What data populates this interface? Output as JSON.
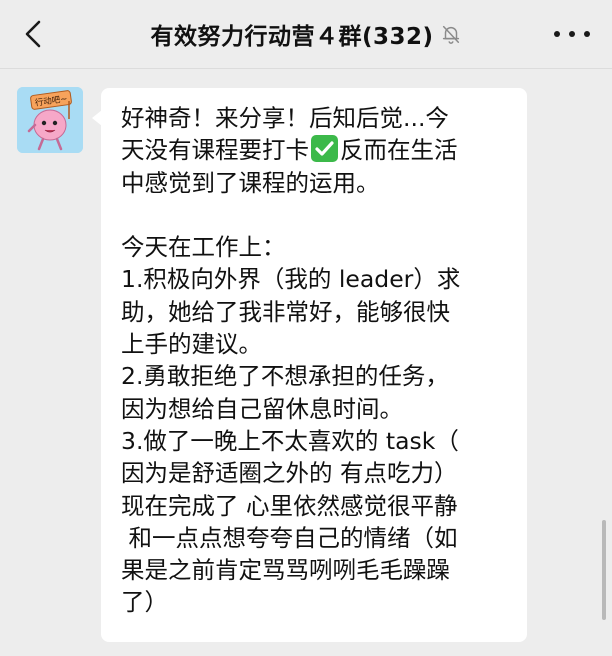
{
  "header": {
    "title": "有效努力行动营４群(332)",
    "back_icon": "chevron-left-icon",
    "mute_icon": "bell-muted-icon",
    "more_icon": "more-dots-icon"
  },
  "message": {
    "avatar_sign": "行动吧~",
    "line1": "好神奇！来分享！后知后觉...今",
    "line2_a": "天没有课程要打卡",
    "line2_emoji": "check-mark-button-icon",
    "line2_b": "反而在生活",
    "line3": "中感觉到了课程的运用。",
    "line4": "",
    "line5": "今天在工作上：",
    "line6": "1.积极向外界（我的 leader）求",
    "line7": "助，她给了我非常好，能够很快",
    "line8": "上手的建议。",
    "line9": "2.勇敢拒绝了不想承担的任务，",
    "line10": "因为想给自己留休息时间。",
    "line11": "3.做了一晚上不太喜欢的 task（",
    "line12": "因为是舒适圈之外的 有点吃力）",
    "line13": "现在完成了 心里依然感觉很平静",
    "line14": " 和一点点想夸夸自己的情绪（如",
    "line15": "果是之前肯定骂骂咧咧毛毛躁躁",
    "line16": "了）"
  },
  "colors": {
    "background": "#ededed",
    "bubble": "#ffffff",
    "check": "#3cb94a",
    "avatar_bg": "#a9dcf4",
    "mascot": "#f6a8c8"
  }
}
